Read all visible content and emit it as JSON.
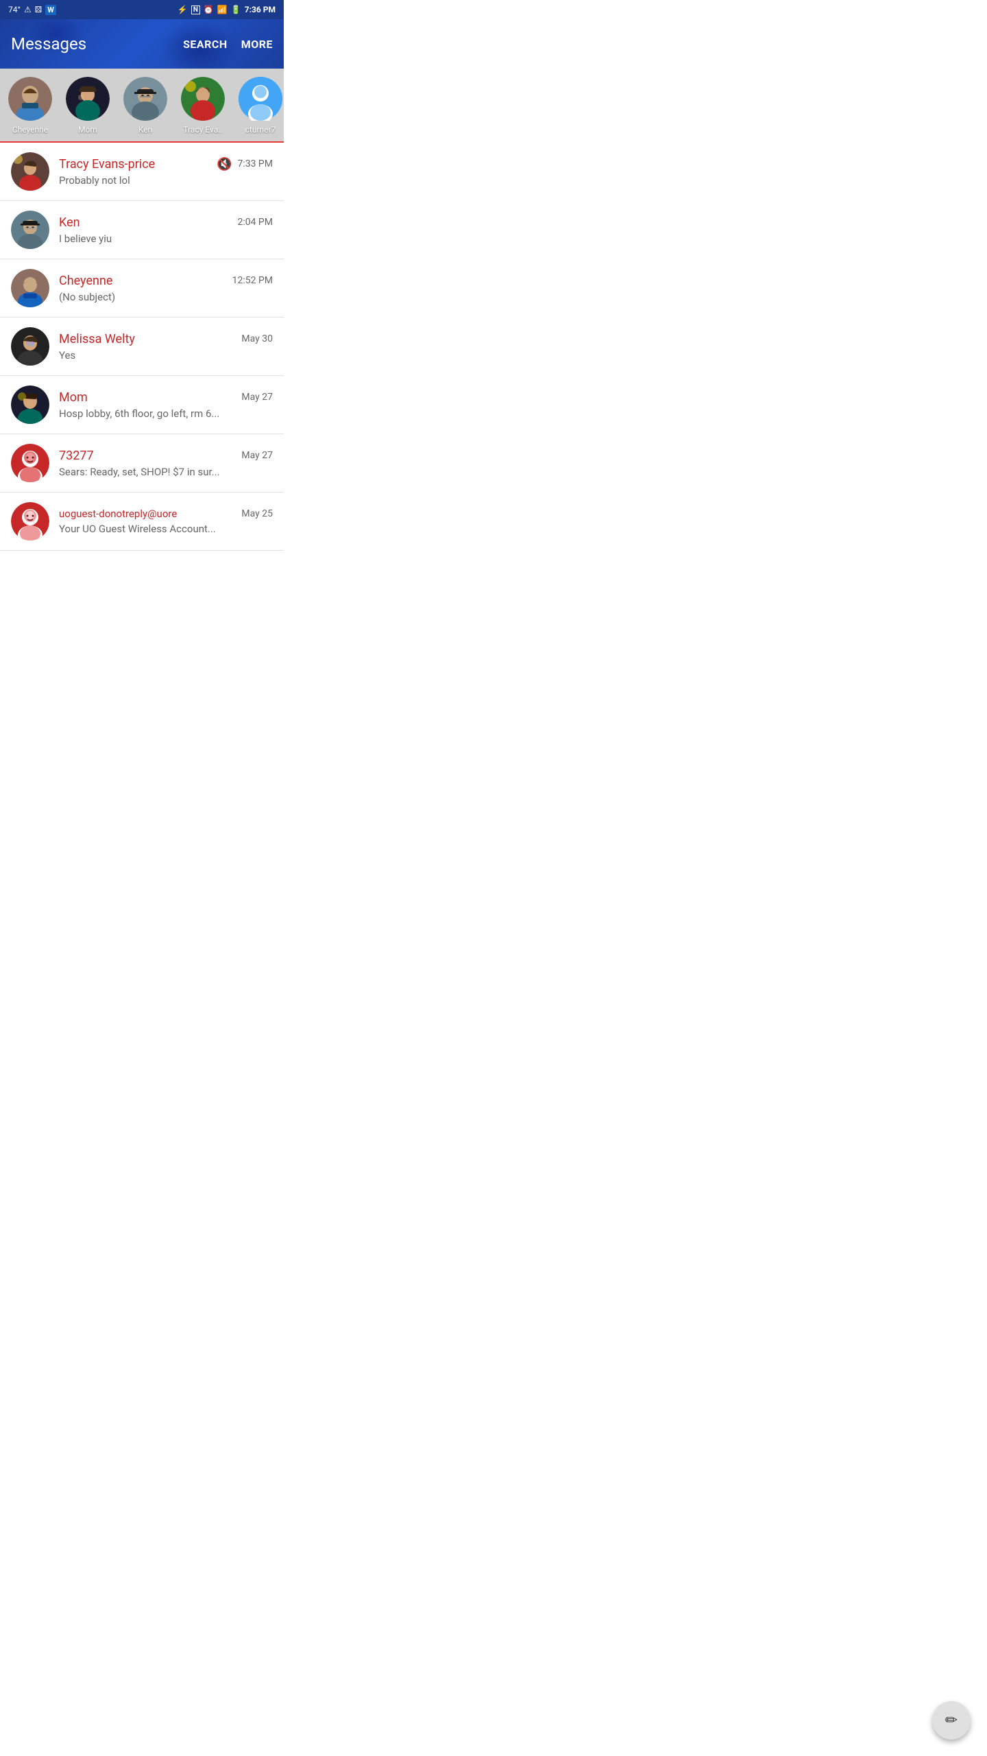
{
  "status_bar": {
    "temp": "74°",
    "time": "7:36 PM"
  },
  "app_bar": {
    "title": "Messages",
    "search_label": "SEARCH",
    "more_label": "MORE"
  },
  "favorites": [
    {
      "name": "Cheyenne",
      "color": "#8d6e63",
      "type": "photo"
    },
    {
      "name": "Mom",
      "color": "#00897b",
      "type": "photo"
    },
    {
      "name": "Ken",
      "color": "#546e7a",
      "type": "photo"
    },
    {
      "name": "Tracy Eva..",
      "color": "#6d4c41",
      "type": "photo"
    },
    {
      "name": "cturner7",
      "color": "#42a5f5",
      "type": "placeholder"
    }
  ],
  "messages": [
    {
      "name": "Tracy Evans-price",
      "preview": "Probably not lol",
      "time": "7:33 PM",
      "muted": true,
      "color": "#6d4c41"
    },
    {
      "name": "Ken",
      "preview": "I believe yiu",
      "time": "2:04 PM",
      "muted": false,
      "color": "#546e7a"
    },
    {
      "name": "Cheyenne",
      "preview": "(No subject)",
      "time": "12:52 PM",
      "muted": false,
      "color": "#8d6e63"
    },
    {
      "name": "Melissa Welty",
      "preview": "Yes",
      "time": "May 30",
      "muted": false,
      "color": "#212121"
    },
    {
      "name": "Mom",
      "preview": "Hosp lobby, 6th floor, go left, rm 6...",
      "time": "May 27",
      "muted": false,
      "color": "#00695c"
    },
    {
      "name": "73277",
      "preview": "Sears: Ready, set, SHOP! $7 in sur...",
      "time": "May 27",
      "muted": false,
      "color": "#c62828"
    },
    {
      "name": "uoguest-donotreply@uore",
      "preview": "Your UO Guest Wireless Account...",
      "time": "May 25",
      "muted": false,
      "color": "#c62828"
    }
  ],
  "fab": {
    "icon": "✏"
  }
}
